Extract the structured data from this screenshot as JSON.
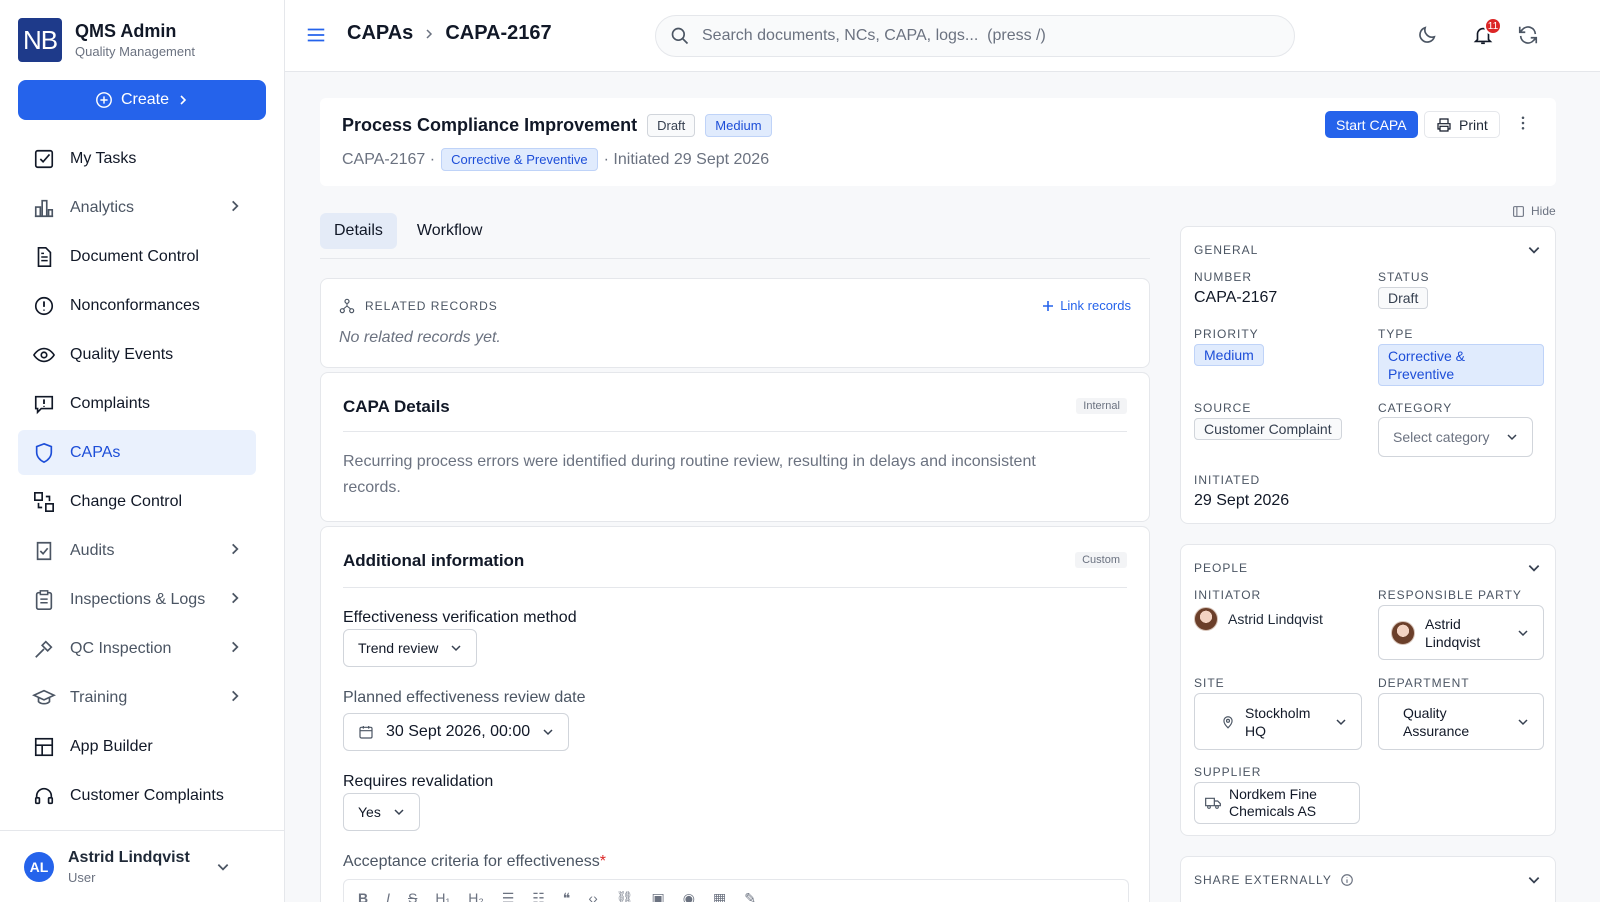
{
  "brand": {
    "logo": "NB",
    "title": "QMS Admin",
    "subtitle": "Quality Management"
  },
  "create_label": "Create",
  "nav": [
    {
      "label": "My Tasks",
      "icon": "checkbox-icon",
      "chevron": false,
      "active": false
    },
    {
      "label": "Analytics",
      "icon": "bar-chart-icon",
      "chevron": true,
      "active": false
    },
    {
      "label": "Document Control",
      "icon": "document-icon",
      "chevron": false,
      "active": false
    },
    {
      "label": "Nonconformances",
      "icon": "alert-circle-icon",
      "chevron": false,
      "active": false
    },
    {
      "label": "Quality Events",
      "icon": "eye-icon",
      "chevron": false,
      "active": false
    },
    {
      "label": "Complaints",
      "icon": "message-alert-icon",
      "chevron": false,
      "active": false
    },
    {
      "label": "CAPAs",
      "icon": "shield-icon",
      "chevron": false,
      "active": true
    },
    {
      "label": "Change Control",
      "icon": "git-compare-icon",
      "chevron": false,
      "active": false
    },
    {
      "label": "Audits",
      "icon": "clipboard-check-icon",
      "chevron": true,
      "active": false
    },
    {
      "label": "Inspections & Logs",
      "icon": "clipboard-list-icon",
      "chevron": true,
      "active": false
    },
    {
      "label": "QC Inspection",
      "icon": "tools-icon",
      "chevron": true,
      "active": false
    },
    {
      "label": "Training",
      "icon": "graduation-cap-icon",
      "chevron": true,
      "active": false
    },
    {
      "label": "App Builder",
      "icon": "grid-layout-icon",
      "chevron": false,
      "active": false
    },
    {
      "label": "Customer Complaints",
      "icon": "headset-icon",
      "chevron": false,
      "active": false
    }
  ],
  "user": {
    "initials": "AL",
    "name": "Astrid Lindqvist",
    "role": "User"
  },
  "topbar": {
    "breadcrumb": [
      "CAPAs",
      "CAPA-2167"
    ],
    "search_placeholder": "Search documents, NCs, CAPA, logs...  (press /)",
    "notification_count": "11"
  },
  "header": {
    "title": "Process Compliance Improvement",
    "status_badge": "Draft",
    "priority_badge": "Medium",
    "number": "CAPA-2167 ·",
    "type_badge": "Corrective & Preventive",
    "initiated": "· Initiated 29 Sept 2026",
    "start_label": "Start CAPA",
    "print_label": "Print"
  },
  "tabs": [
    "Details",
    "Workflow"
  ],
  "related": {
    "title": "RELATED RECORDS",
    "link_label": "Link records",
    "empty": "No related records yet."
  },
  "capa_details": {
    "title": "CAPA Details",
    "tag": "Internal",
    "description": "Recurring process errors were identified during routine review, resulting in delays and inconsistent records."
  },
  "additional": {
    "title": "Additional information",
    "tag": "Custom",
    "method_label": "Effectiveness verification method",
    "method_value": "Trend review",
    "review_date_label": "Planned effectiveness review date",
    "review_date_value": "30 Sept 2026, 00:00",
    "revalidation_label": "Requires revalidation",
    "revalidation_value": "Yes",
    "criteria_label": "Acceptance criteria for effectiveness",
    "criteria_required": "*"
  },
  "panel": {
    "hide_label": "Hide",
    "general": {
      "title": "GENERAL",
      "number_label": "NUMBER",
      "number_value": "CAPA-2167",
      "status_label": "STATUS",
      "status_value": "Draft",
      "priority_label": "PRIORITY",
      "priority_value": "Medium",
      "type_label": "TYPE",
      "type_value_1": "Corrective &",
      "type_value_2": "Preventive",
      "source_label": "SOURCE",
      "source_value": "Customer Complaint",
      "category_label": "CATEGORY",
      "category_placeholder": "Select category",
      "initiated_label": "INITIATED",
      "initiated_value": "29 Sept 2026"
    },
    "people": {
      "title": "PEOPLE",
      "initiator_label": "INITIATOR",
      "initiator_value": "Astrid Lindqvist",
      "responsible_label": "RESPONSIBLE PARTY",
      "responsible_value_1": "Astrid",
      "responsible_value_2": "Lindqvist",
      "site_label": "SITE",
      "site_value_1": "Stockholm",
      "site_value_2": "HQ",
      "department_label": "DEPARTMENT",
      "department_value_1": "Quality",
      "department_value_2": "Assurance",
      "supplier_label": "SUPPLIER",
      "supplier_value_1": "Nordkem Fine",
      "supplier_value_2": "Chemicals AS"
    },
    "share": {
      "title": "SHARE EXTERNALLY"
    }
  },
  "colors": {
    "accent": "#2563eb",
    "active_nav_bg": "#eaf1fd",
    "badge_blue_bg": "#e0ebfd",
    "alert": "#dc2626"
  }
}
